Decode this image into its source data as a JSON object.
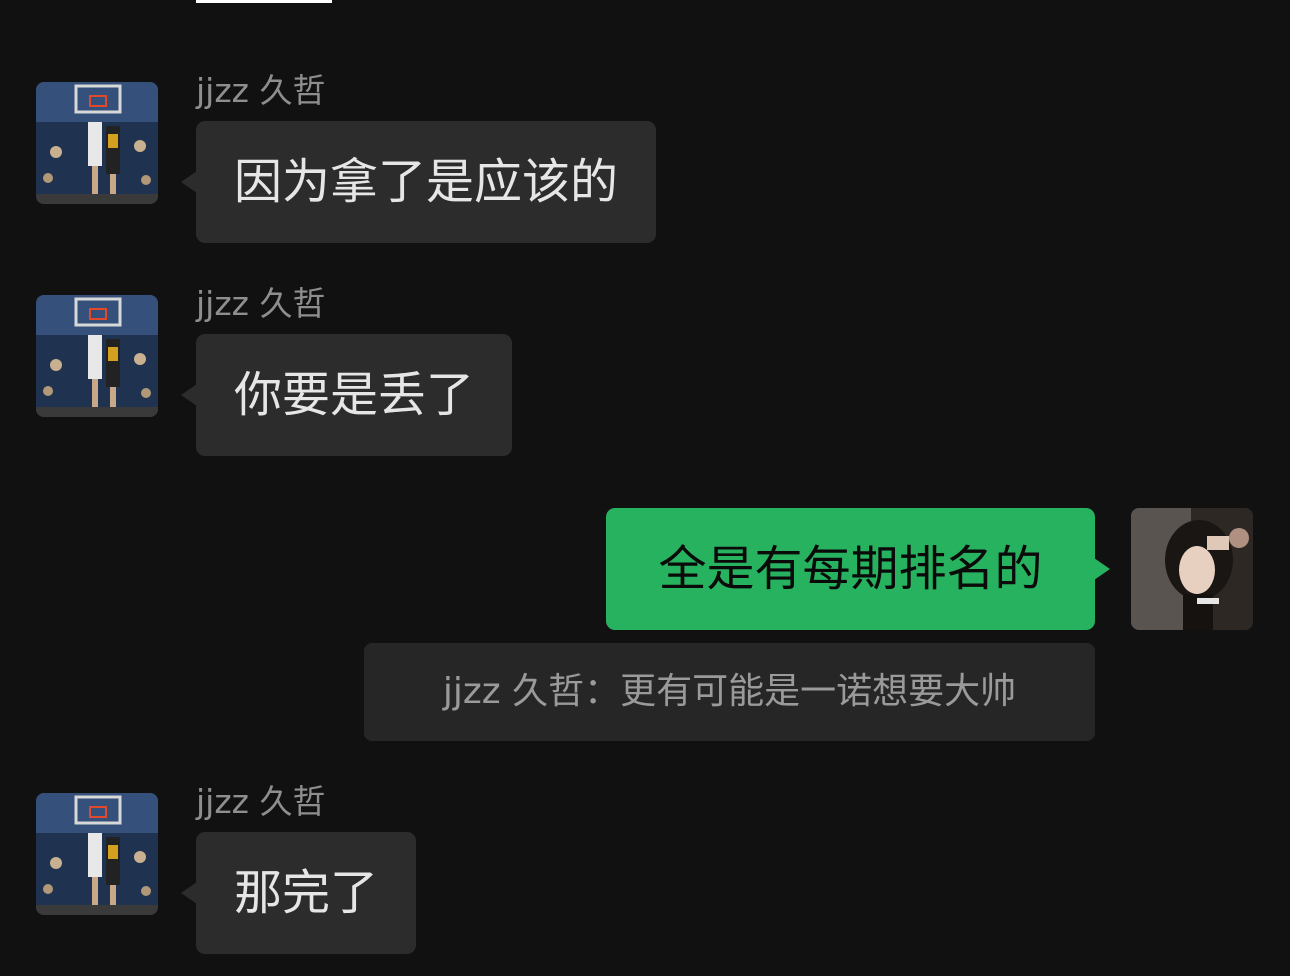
{
  "chat": {
    "messages": [
      {
        "sender": "jjzz 久哲",
        "text": "因为拿了是应该的",
        "direction": "incoming"
      },
      {
        "sender": "jjzz 久哲",
        "text": "你要是丢了",
        "direction": "incoming"
      },
      {
        "text": "全是有每期排名的",
        "direction": "outgoing",
        "quote": {
          "sender": "jjzz 久哲",
          "separator": "：",
          "text": "更有可能是一诺想要大帅"
        }
      },
      {
        "sender": "jjzz 久哲",
        "text": "那完了",
        "direction": "incoming"
      }
    ]
  },
  "colors": {
    "background": "#111111",
    "incoming_bubble": "#2c2c2c",
    "outgoing_bubble": "#27b25f",
    "quote_box": "#262626",
    "sender_name": "#8e8e8e"
  }
}
